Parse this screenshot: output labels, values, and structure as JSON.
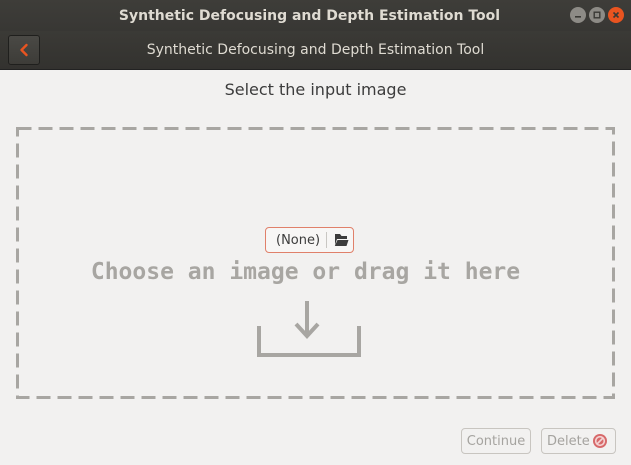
{
  "window": {
    "title": "Synthetic Defocusing and Depth Estimation Tool",
    "controls": [
      "minimize-icon",
      "maximize-icon",
      "close-icon"
    ],
    "accent": "#e95420"
  },
  "headerbar": {
    "title": "Synthetic Defocusing and Depth Estimation Tool",
    "back_icon": "chevron-left-icon"
  },
  "main": {
    "heading": "Select the input image",
    "file_chooser": {
      "value": "(None)",
      "icon": "open-file-icon"
    },
    "drop_prompt": "Choose an image or drag it here",
    "drop_icon": "download-tray-icon"
  },
  "actions": {
    "continue_label": "Continue",
    "delete_label": "Delete",
    "delete_icon": "no-entry-icon"
  }
}
